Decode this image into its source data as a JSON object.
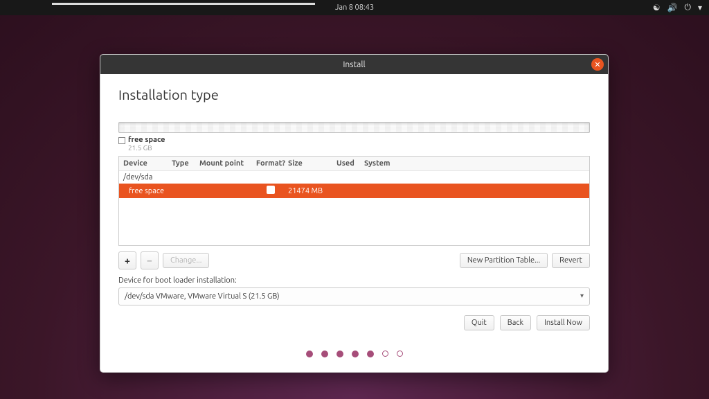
{
  "topbar": {
    "clock": "Jan 8  08:43"
  },
  "window": {
    "title": "Install"
  },
  "page": {
    "title": "Installation type"
  },
  "legend": {
    "label": "free space",
    "size": "21.5 GB"
  },
  "table": {
    "headers": {
      "device": "Device",
      "type": "Type",
      "mount": "Mount point",
      "format": "Format?",
      "size": "Size",
      "used": "Used",
      "system": "System"
    },
    "device_row": "/dev/sda",
    "selected_row": {
      "device": "free space",
      "size": "21474 MB"
    }
  },
  "toolbar": {
    "plus": "+",
    "minus": "−",
    "change": "Change...",
    "newtable": "New Partition Table...",
    "revert": "Revert"
  },
  "bootloader": {
    "label": "Device for boot loader installation:",
    "selected": "/dev/sda VMware, VMware Virtual S (21.5 GB)"
  },
  "footer": {
    "quit": "Quit",
    "back": "Back",
    "install": "Install Now"
  }
}
